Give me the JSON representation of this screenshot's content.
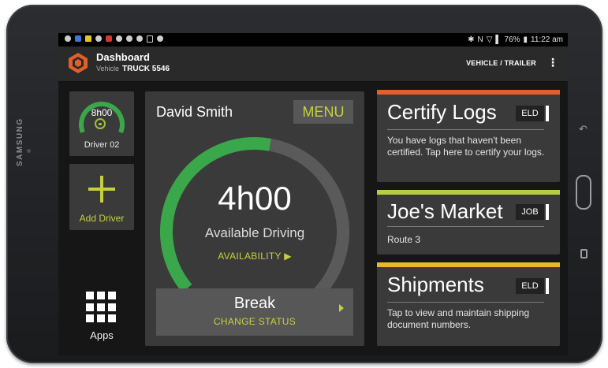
{
  "device": {
    "brand": "SAMSUNG"
  },
  "status_bar": {
    "right_text": "76%",
    "time": "11:22 am"
  },
  "app_bar": {
    "title": "Dashboard",
    "vehicle_label": "Vehicle",
    "vehicle_value": "TRUCK 5546",
    "vehicle_trailer_button": "VEHICLE / TRAILER",
    "overflow_icon": "kebab-menu-icon"
  },
  "driver_tile": {
    "time": "8h00",
    "label": "Driver 02",
    "level": 1.0,
    "icon": "steering-wheel-icon"
  },
  "add_driver": {
    "label": "Add Driver",
    "icon": "plus-icon"
  },
  "apps": {
    "label": "Apps",
    "icon": "grid-icon"
  },
  "driver_panel": {
    "driver_name": "David Smith",
    "menu_label": "MENU",
    "remaining_time": "4h00",
    "remaining_label": "Available Driving",
    "availability_link": "AVAILABILITY",
    "gauge_level": 0.5,
    "status_title": "Break",
    "status_action": "CHANGE STATUS"
  },
  "cards": [
    {
      "title": "Certify Logs",
      "tag": "ELD",
      "body": "You have logs that haven't been certified. Tap here to certify your logs.",
      "accent": "#e0602a"
    },
    {
      "title": "Joe's Market",
      "tag": "JOB",
      "body": "Route 3",
      "accent": "#b6cf3a"
    },
    {
      "title": "Shipments",
      "tag": "ELD",
      "body": "Tap to view and maintain shipping document numbers.",
      "accent": "#e8b924"
    }
  ],
  "colors": {
    "accent_green": "#c6d13a",
    "gauge_green": "#3aa84a",
    "panel": "#3a3a3a"
  }
}
